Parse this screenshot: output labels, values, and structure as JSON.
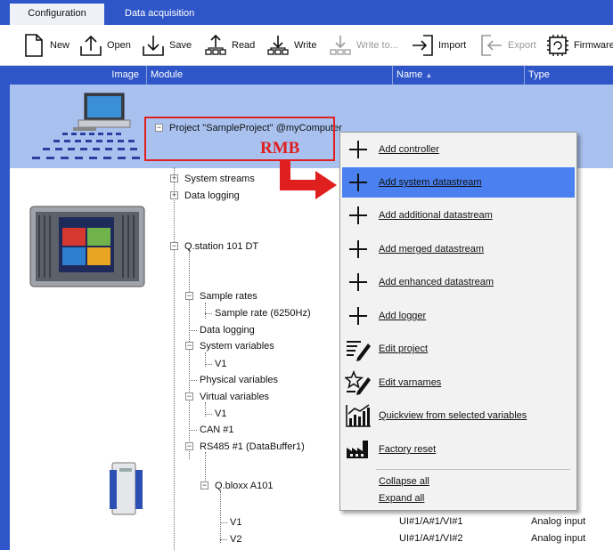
{
  "tabs": [
    {
      "label": "Configuration",
      "active": true
    },
    {
      "label": "Data acquisition",
      "active": false
    }
  ],
  "toolbar": {
    "new": "New",
    "open": "Open",
    "save": "Save",
    "read": "Read",
    "write": "Write",
    "write_to": "Write to...",
    "import": "Import",
    "export": "Export",
    "firmware": "Firmware"
  },
  "columns": {
    "image": "Image",
    "module": "Module",
    "name": "Name",
    "type": "Type"
  },
  "tree": {
    "project": "Project \"SampleProject\" @myComputer",
    "system_streams": "System streams",
    "data_logging_top": "Data logging",
    "qstation": "Q.station 101 DT",
    "sample_rates": "Sample rates",
    "sample_rate": "Sample rate (6250Hz)",
    "data_logging": "Data logging",
    "system_variables": "System variables",
    "sys_v1": "V1",
    "physical_variables": "Physical variables",
    "virtual_variables": "Virtual variables",
    "virt_v1": "V1",
    "can1": "CAN #1",
    "rs485": "RS485 #1 (DataBuffer1)",
    "qbloxx": "Q.bloxx A101",
    "v1": "V1",
    "v2": "V2"
  },
  "rows": [
    {
      "name": "UI#1/A#1/VI#1",
      "type": "Analog input"
    },
    {
      "name": "UI#1/A#1/VI#2",
      "type": "Analog input"
    }
  ],
  "annotation": "RMB",
  "menu": [
    {
      "label": "Add controller",
      "icon": "plus-icon"
    },
    {
      "label": "Add system datastream",
      "icon": "plus-icon",
      "active": true
    },
    {
      "label": "Add additional datastream",
      "icon": "plus-icon"
    },
    {
      "label": "Add merged datastream",
      "icon": "plus-icon"
    },
    {
      "label": "Add enhanced datastream",
      "icon": "plus-icon"
    },
    {
      "label": "Add logger",
      "icon": "plus-icon"
    },
    {
      "label": "Edit project",
      "icon": "edit-list-icon"
    },
    {
      "label": "Edit varnames",
      "icon": "edit-star-icon"
    },
    {
      "label": "Quickview from selected variables",
      "icon": "chart-icon"
    },
    {
      "label": "Factory reset",
      "icon": "factory-icon"
    },
    {
      "label": "Collapse all",
      "icon": ""
    },
    {
      "label": "Expand all",
      "icon": ""
    }
  ],
  "colors": {
    "accent": "#2f56c8",
    "selection": "#a9c1ef",
    "menu_highlight": "#4a80f0",
    "annotation": "#e0201e"
  }
}
